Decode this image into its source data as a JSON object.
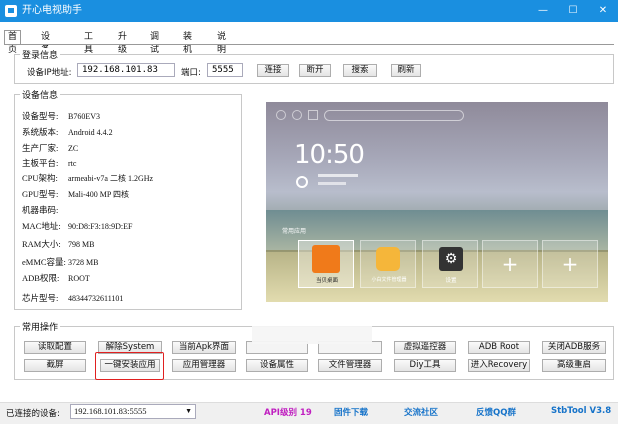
{
  "window": {
    "title": "开心电视助手",
    "min_glyph": "—",
    "max_glyph": "☐",
    "close_glyph": "✕"
  },
  "tabs": [
    "首页",
    "设备管理",
    "工具箱",
    "升级",
    "调试",
    "装机",
    "说明"
  ],
  "login": {
    "group_title": "登录信息",
    "ip_label": "设备IP地址:",
    "ip_value": "192.168.101.83",
    "port_label": "端口:",
    "port_value": "5555",
    "buttons": [
      "连接",
      "断开",
      "搜索",
      "刷新"
    ]
  },
  "device": {
    "group_title": "设备信息",
    "rows": [
      {
        "k": "设备型号:",
        "v": "B760EV3"
      },
      {
        "k": "系统版本:",
        "v": "Android 4.4.2"
      },
      {
        "k": "生产厂家:",
        "v": "ZC"
      },
      {
        "k": "主板平台:",
        "v": "rtc"
      },
      {
        "k": "CPU架构:",
        "v": "armeabi-v7a 二核 1.2GHz"
      },
      {
        "k": "GPU型号:",
        "v": "Mali-400 MP 四核"
      },
      {
        "k": "机器串码:",
        "v": ""
      },
      {
        "k": "MAC地址:",
        "v": "90:D8:F3:18:9D:EF"
      },
      {
        "k": "RAM大小:",
        "v": "798 MB"
      },
      {
        "k": "eMMC容量:",
        "v": "3728 MB"
      },
      {
        "k": "ADB权限:",
        "v": "ROOT"
      },
      {
        "k": "芯片型号:",
        "v": "48344732611101"
      }
    ]
  },
  "preview": {
    "clock": "10:50",
    "section_label": "常用应用",
    "apps": [
      "当贝桌面",
      "小白文件管理器",
      "设置"
    ]
  },
  "ops": {
    "group_title": "常用操作",
    "row1": [
      "读取配置",
      "解除System",
      "当前Apk界面",
      "",
      "",
      "虚拟遥控器",
      "ADB Root",
      "关闭ADB服务"
    ],
    "row2": [
      "截屏",
      "一键安装应用",
      "应用管理器",
      "设备属性",
      "文件管理器",
      "Diy工具",
      "进入Recovery",
      "高级重启"
    ]
  },
  "status": {
    "connected_label": "已连接的设备:",
    "connected_value": "192.168.101.83:5555",
    "api_level": "API级别 19",
    "links": [
      "固件下载",
      "交流社区",
      "反馈QQ群"
    ],
    "version": "StbTool V3.8"
  },
  "colors": {
    "titlebar": "#1a8fe0",
    "highlight_border": "#e02020",
    "link": "#1673c9"
  }
}
